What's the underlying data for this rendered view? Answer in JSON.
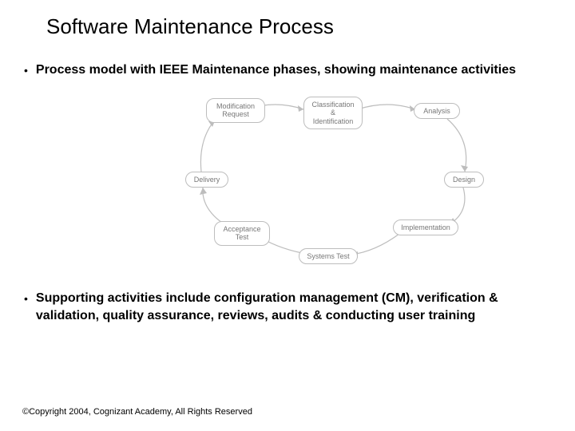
{
  "title": "Software Maintenance Process",
  "bullets": {
    "top": "Process model with IEEE Maintenance phases, showing maintenance activities",
    "bottom": "Supporting activities include configuration management (CM), verification & validation, quality assurance, reviews, audits & conducting user training"
  },
  "diagram": {
    "nodes": {
      "modreq": "Modification\nRequest",
      "classid": "Classification\n&\nIdentification",
      "analysis": "Analysis",
      "design": "Design",
      "implementation": "Implementation",
      "systest": "Systems Test",
      "acctest": "Acceptance\nTest",
      "delivery": "Delivery"
    }
  },
  "footer": "©Copyright 2004, Cognizant Academy, All Rights Reserved"
}
